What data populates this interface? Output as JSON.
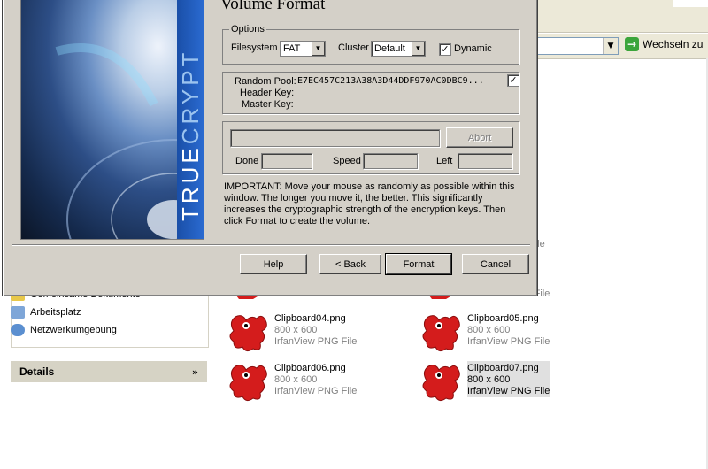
{
  "explorer": {
    "address_bar": {
      "go_label": "Wechseln zu"
    },
    "places": [
      {
        "label": "Gemeinsame Dokumente",
        "icon": "shared-docs-icon"
      },
      {
        "label": "Arbeitsplatz",
        "icon": "computer-icon"
      },
      {
        "label": "Netzwerkumgebung",
        "icon": "network-icon"
      }
    ],
    "details": {
      "label": "Details"
    },
    "files": [
      {
        "name": "Clipboard04.png",
        "dims": "800 x 600",
        "type": "IrfanView PNG File"
      },
      {
        "name": "Clipboard05.png",
        "dims": "800 x 600",
        "type": "IrfanView PNG File"
      },
      {
        "name": "Clipboard06.png",
        "dims": "800 x 600",
        "type": "IrfanView PNG File"
      },
      {
        "name": "Clipboard07.png",
        "dims": "800 x 600",
        "type": "IrfanView PNG File"
      }
    ],
    "partial_files": [
      {
        "text": "File"
      },
      {
        "text": "IrfanView PNG File"
      },
      {
        "text": "IrfanView PNG File"
      }
    ]
  },
  "dialog": {
    "title": "Volume Format",
    "banner_text": {
      "part1": "TRUE",
      "part2": "CRYPT"
    },
    "options": {
      "group_label": "Options",
      "filesystem_label": "Filesystem",
      "filesystem_value": "FAT",
      "cluster_label": "Cluster",
      "cluster_value": "Default",
      "dynamic_label": "Dynamic",
      "dynamic_checked": true
    },
    "keys": {
      "random_pool_label": "Random Pool:",
      "random_pool_value": "E7EC457C213A38A3D44DDF970AC0DBC9...",
      "header_key_label": "Header Key:",
      "master_key_label": "Master Key:",
      "display_checked": true
    },
    "progress": {
      "abort_label": "Abort",
      "done_label": "Done",
      "speed_label": "Speed",
      "left_label": "Left"
    },
    "info_text": "IMPORTANT: Move your mouse as randomly as possible within this window. The longer you move it, the better. This significantly increases the cryptographic strength of the encryption keys. Then click Format to create the volume.",
    "buttons": {
      "help": "Help",
      "back": "< Back",
      "format": "Format",
      "cancel": "Cancel"
    }
  }
}
